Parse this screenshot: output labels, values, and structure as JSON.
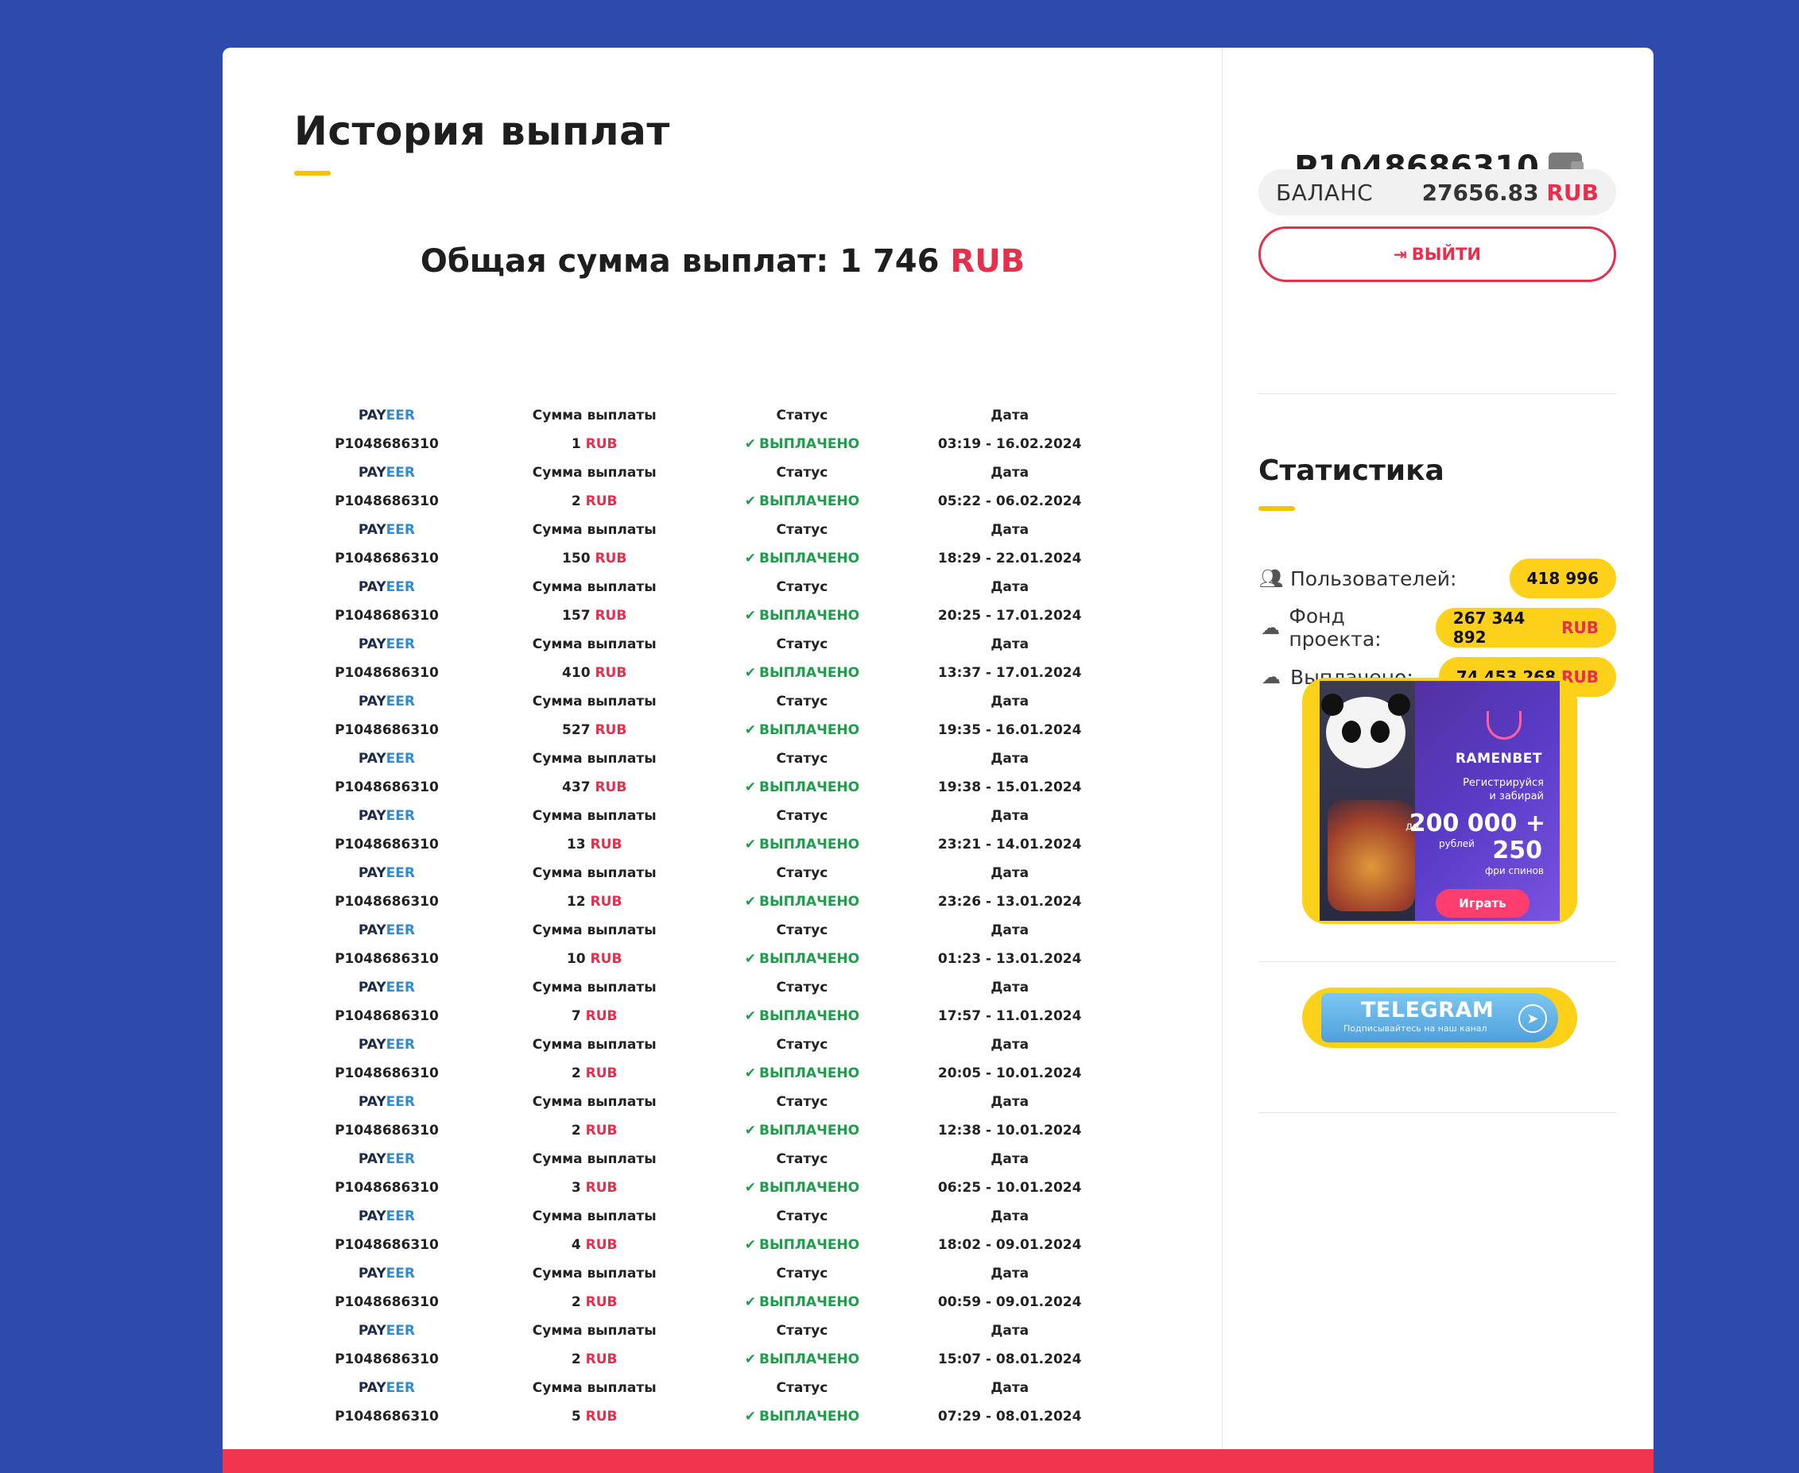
{
  "history": {
    "title": "История выплат",
    "total_label": "Общая сумма выплат:",
    "total_value": "1 746",
    "total_currency": "RUB"
  },
  "table": {
    "header": {
      "system_a": "PAY",
      "system_b": "EER",
      "amount": "Сумма выплаты",
      "status": "Статус",
      "date": "Дата"
    },
    "rows": [
      {
        "wallet": "P1048686310",
        "amount": "1",
        "currency": "RUB",
        "status": "ВЫПЛАЧЕНО",
        "date": "03:19 - 16.02.2024"
      },
      {
        "wallet": "P1048686310",
        "amount": "2",
        "currency": "RUB",
        "status": "ВЫПЛАЧЕНО",
        "date": "05:22 - 06.02.2024"
      },
      {
        "wallet": "P1048686310",
        "amount": "150",
        "currency": "RUB",
        "status": "ВЫПЛАЧЕНО",
        "date": "18:29 - 22.01.2024"
      },
      {
        "wallet": "P1048686310",
        "amount": "157",
        "currency": "RUB",
        "status": "ВЫПЛАЧЕНО",
        "date": "20:25 - 17.01.2024"
      },
      {
        "wallet": "P1048686310",
        "amount": "410",
        "currency": "RUB",
        "status": "ВЫПЛАЧЕНО",
        "date": "13:37 - 17.01.2024"
      },
      {
        "wallet": "P1048686310",
        "amount": "527",
        "currency": "RUB",
        "status": "ВЫПЛАЧЕНО",
        "date": "19:35 - 16.01.2024"
      },
      {
        "wallet": "P1048686310",
        "amount": "437",
        "currency": "RUB",
        "status": "ВЫПЛАЧЕНО",
        "date": "19:38 - 15.01.2024"
      },
      {
        "wallet": "P1048686310",
        "amount": "13",
        "currency": "RUB",
        "status": "ВЫПЛАЧЕНО",
        "date": "23:21 - 14.01.2024"
      },
      {
        "wallet": "P1048686310",
        "amount": "12",
        "currency": "RUB",
        "status": "ВЫПЛАЧЕНО",
        "date": "23:26 - 13.01.2024"
      },
      {
        "wallet": "P1048686310",
        "amount": "10",
        "currency": "RUB",
        "status": "ВЫПЛАЧЕНО",
        "date": "01:23 - 13.01.2024"
      },
      {
        "wallet": "P1048686310",
        "amount": "7",
        "currency": "RUB",
        "status": "ВЫПЛАЧЕНО",
        "date": "17:57 - 11.01.2024"
      },
      {
        "wallet": "P1048686310",
        "amount": "2",
        "currency": "RUB",
        "status": "ВЫПЛАЧЕНО",
        "date": "20:05 - 10.01.2024"
      },
      {
        "wallet": "P1048686310",
        "amount": "2",
        "currency": "RUB",
        "status": "ВЫПЛАЧЕНО",
        "date": "12:38 - 10.01.2024"
      },
      {
        "wallet": "P1048686310",
        "amount": "3",
        "currency": "RUB",
        "status": "ВЫПЛАЧЕНО",
        "date": "06:25 - 10.01.2024"
      },
      {
        "wallet": "P1048686310",
        "amount": "4",
        "currency": "RUB",
        "status": "ВЫПЛАЧЕНО",
        "date": "18:02 - 09.01.2024"
      },
      {
        "wallet": "P1048686310",
        "amount": "2",
        "currency": "RUB",
        "status": "ВЫПЛАЧЕНО",
        "date": "00:59 - 09.01.2024"
      },
      {
        "wallet": "P1048686310",
        "amount": "2",
        "currency": "RUB",
        "status": "ВЫПЛАЧЕНО",
        "date": "15:07 - 08.01.2024"
      },
      {
        "wallet": "P1048686310",
        "amount": "5",
        "currency": "RUB",
        "status": "ВЫПЛАЧЕНО",
        "date": "07:29 - 08.01.2024"
      }
    ]
  },
  "account": {
    "wallet_id": "P1048686310",
    "wallet_icon": "wallet-icon",
    "balance_label": "БАЛАНС",
    "balance_value": "27656.83",
    "balance_currency": "RUB",
    "logout_label": "ВЫЙТИ",
    "logout_icon": "sign-out-icon"
  },
  "stats": {
    "title": "Статистика",
    "users_label": "Пользователей:",
    "users_value": "418 996",
    "fund_label": "Фонд проекта:",
    "fund_value": "267 344 892",
    "fund_currency": "RUB",
    "paid_label": "Выплачено:",
    "paid_value": "74 453 268",
    "paid_currency": "RUB"
  },
  "banner": {
    "brand": "RAMENBET",
    "subtitle_1": "Регистрируйся",
    "subtitle_2": "и забирай",
    "prefix": "до",
    "amount": "200 000 +",
    "amount_unit": "рублей",
    "spins": "250",
    "spins_label": "фри спинов",
    "play": "Играть"
  },
  "telegram": {
    "title": "TELEGRAM",
    "subtitle": "Подписывайтесь на наш канал"
  },
  "colors": {
    "background": "#2f4aad",
    "accent_red": "#e62e4d",
    "accent_yellow": "#fdd01a",
    "status_green": "#1e9e4a",
    "payeer_blue": "#2f8bd4"
  }
}
